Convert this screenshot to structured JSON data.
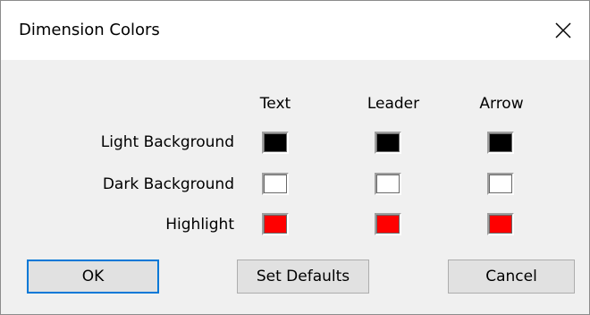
{
  "dialog": {
    "title": "Dimension Colors"
  },
  "columns": [
    "Text",
    "Leader",
    "Arrow"
  ],
  "rows": [
    {
      "label": "Light Background",
      "colors": [
        "#000000",
        "#000000",
        "#000000"
      ]
    },
    {
      "label": "Dark Background",
      "colors": [
        "#ffffff",
        "#ffffff",
        "#ffffff"
      ]
    },
    {
      "label": "Highlight",
      "colors": [
        "#ff0000",
        "#ff0000",
        "#ff0000"
      ]
    }
  ],
  "buttons": {
    "ok": "OK",
    "set_defaults": "Set Defaults",
    "cancel": "Cancel"
  },
  "icons": {
    "close": "close-icon"
  }
}
